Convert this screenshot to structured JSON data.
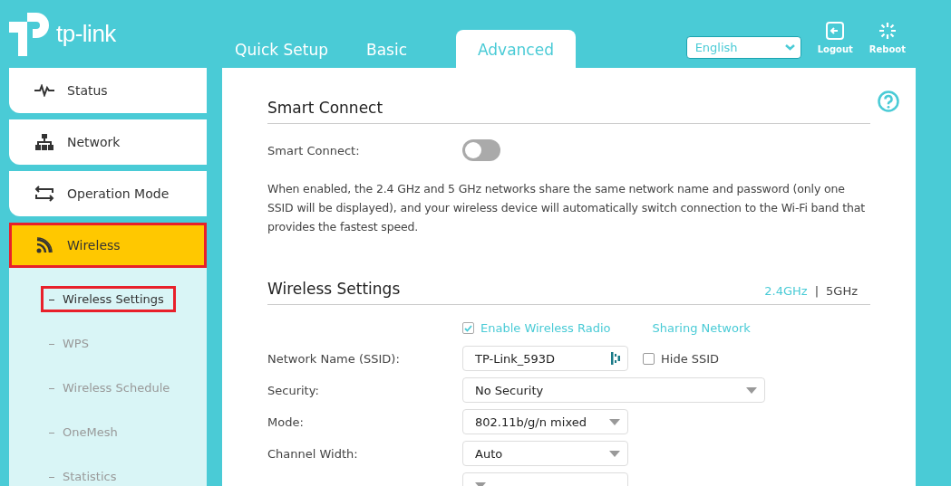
{
  "header": {
    "logo": "tp-link",
    "tabs": [
      {
        "label": "Quick Setup",
        "selected": false
      },
      {
        "label": "Basic",
        "selected": false
      },
      {
        "label": "Advanced",
        "selected": true
      }
    ],
    "language": "English",
    "actions": [
      {
        "label": "Logout",
        "kind": "logout"
      },
      {
        "label": "Reboot",
        "kind": "reboot"
      }
    ]
  },
  "sidebar": {
    "items": [
      {
        "label": "Status",
        "kind": "status",
        "selected": false,
        "highlighted": false
      },
      {
        "label": "Network",
        "kind": "network",
        "selected": false,
        "highlighted": false
      },
      {
        "label": "Operation Mode",
        "kind": "mode",
        "selected": false,
        "highlighted": false
      },
      {
        "label": "Wireless",
        "kind": "wireless",
        "selected": true,
        "highlighted": true,
        "children": [
          {
            "label": "Wireless Settings",
            "selected": true,
            "highlighted": true
          },
          {
            "label": "WPS",
            "selected": false,
            "highlighted": false
          },
          {
            "label": "Wireless Schedule",
            "selected": false,
            "highlighted": false
          },
          {
            "label": "OneMesh",
            "selected": false,
            "highlighted": false
          },
          {
            "label": "Statistics",
            "selected": false,
            "highlighted": false
          }
        ]
      }
    ]
  },
  "smart_connect": {
    "title": "Smart Connect",
    "label": "Smart Connect:",
    "on": false,
    "description": "When enabled, the 2.4 GHz and 5 GHz networks share the same network name and password (only one SSID will be displayed), and your wireless device will automatically switch connection to the Wi-Fi band that provides the fastest speed."
  },
  "wireless_settings": {
    "title": "Wireless Settings",
    "bands": [
      {
        "label": "2.4GHz",
        "selected": true
      },
      {
        "label": "5GHz",
        "selected": false
      }
    ],
    "band_separator": "|",
    "enable_radio": {
      "label": "Enable Wireless Radio",
      "checked": true
    },
    "sharing_network": "Sharing Network",
    "fields": [
      {
        "label": "Network Name (SSID):",
        "value": "TP-Link_593D",
        "kind": "input",
        "hide_ssid": {
          "label": "Hide SSID",
          "checked": false
        }
      },
      {
        "label": "Security:",
        "value": "No Security",
        "kind": "wideselect"
      },
      {
        "label": "Mode:",
        "value": "802.11b/g/n mixed",
        "kind": "select"
      },
      {
        "label": "Channel Width:",
        "value": "Auto",
        "kind": "select"
      },
      {
        "kind": "select"
      }
    ]
  }
}
